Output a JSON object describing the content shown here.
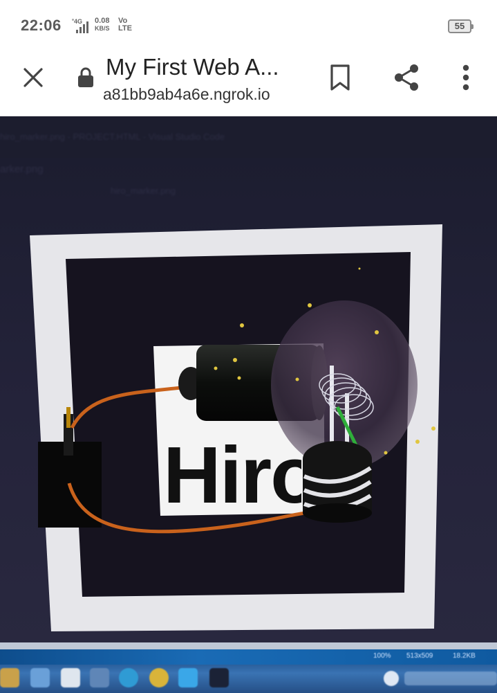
{
  "status_bar": {
    "time": "22:06",
    "network_type": "4G",
    "speed_value": "0.08",
    "speed_unit": "KB/S",
    "volte_top": "Vo",
    "volte_bottom": "LTE",
    "battery": "55"
  },
  "toolbar": {
    "close_icon": "close-icon",
    "lock_icon": "lock-icon",
    "page_title": "My First Web A...",
    "url": "a81bb9ab4a6e.ngrok.io",
    "bookmark_icon": "bookmark-icon",
    "share_icon": "share-icon",
    "menu_icon": "more-vert-icon"
  },
  "camera_view": {
    "marker_text": "Hiro",
    "background_tab_text": "hiro_marker.png - PROJECT.HTML - Visual Studio Code",
    "background_file_tab": "arker.png",
    "background_breadcrumb": "hiro_marker.png",
    "desktop_status": [
      "100%",
      "513x509",
      "18.2KB"
    ]
  },
  "colors": {
    "toolbar_bg": "#ffffff",
    "marker_border": "#e8e8ea",
    "marker_inner": "#15121f",
    "wire": "#c9621c",
    "taskbar": "#2f66a6"
  }
}
